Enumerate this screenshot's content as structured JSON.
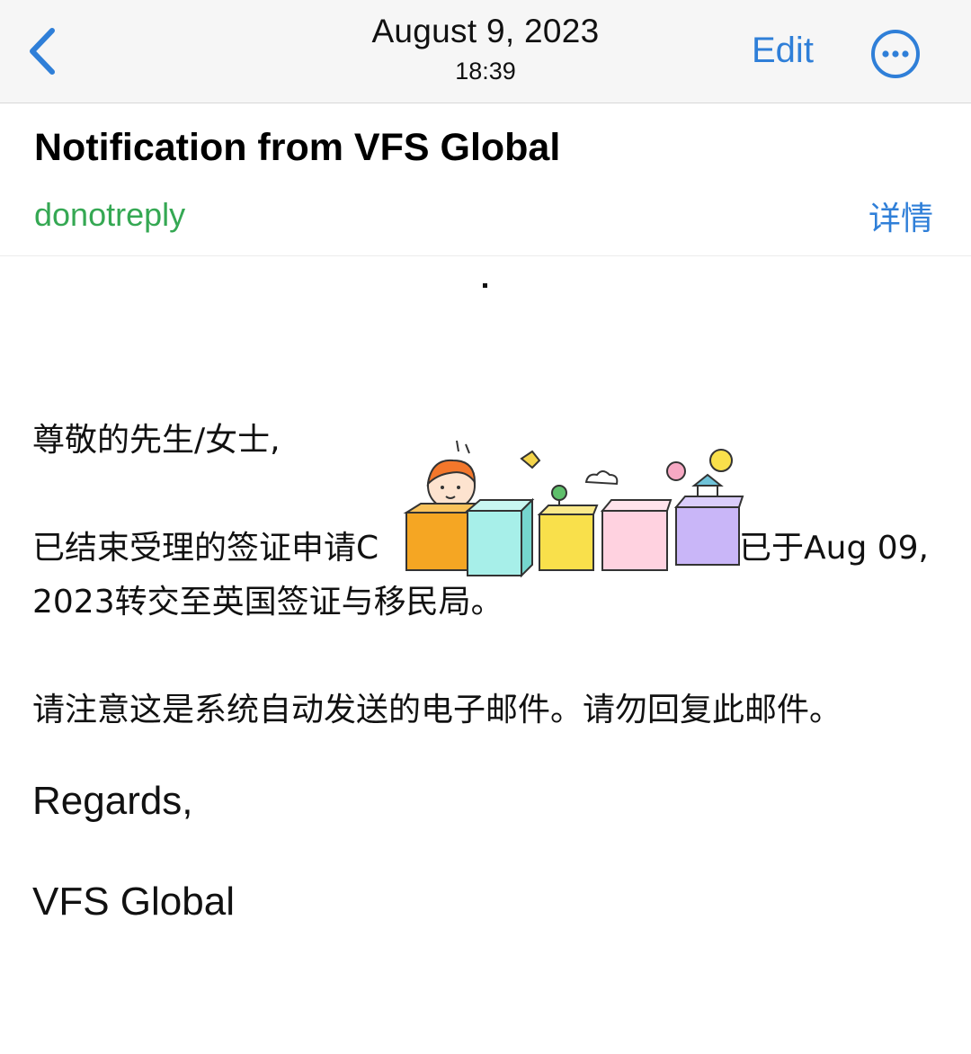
{
  "nav": {
    "date": "August 9, 2023",
    "time": "18:39",
    "edit_label": "Edit"
  },
  "email": {
    "subject": "Notification from VFS Global",
    "sender": "donotreply",
    "details_label": "详情",
    "greeting": "尊敬的先生/女士,",
    "line2_start": "已结束受理的签证申请C",
    "line2_end": "已于Aug 09,",
    "line3": "2023转交至英国签证与移民局。",
    "notice": "请注意这是系统自动发送的电子邮件。请勿回复此邮件。",
    "regards": "Regards,",
    "signature": "VFS Global"
  },
  "colors": {
    "accent": "#2f7fd8",
    "sender": "#35a853",
    "nav_bg": "#f6f6f6"
  },
  "icons": {
    "back": "chevron-left-icon",
    "more": "ellipsis-circle-icon",
    "sticker": "cute-blocks-sticker"
  }
}
